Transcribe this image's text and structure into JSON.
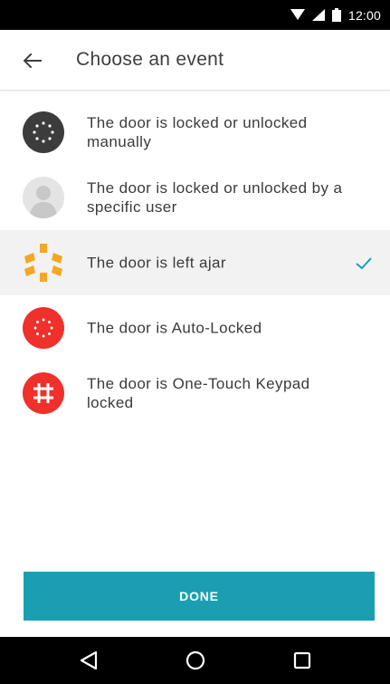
{
  "status_bar": {
    "time": "12:00",
    "icons": [
      "wifi-icon",
      "signal-icon",
      "battery-icon"
    ]
  },
  "app_bar": {
    "title": "Choose an event",
    "back_icon": "arrow-left-icon"
  },
  "events": [
    {
      "label": "The door is locked or unlocked manually",
      "icon": "manual-lock-icon",
      "icon_color": "#3c3c3c",
      "selected": false
    },
    {
      "label": "The door is locked or unlocked by a specific user",
      "icon": "user-avatar-icon",
      "icon_color": "#e4e4e4",
      "selected": false
    },
    {
      "label": "The door is left ajar",
      "icon": "door-ajar-icon",
      "icon_color": "#f5a623",
      "selected": true
    },
    {
      "label": "The door is Auto-Locked",
      "icon": "auto-lock-icon",
      "icon_color": "#f0302a",
      "selected": false
    },
    {
      "label": "The door is One-Touch Keypad locked",
      "icon": "keypad-hash-icon",
      "icon_color": "#f0302a",
      "selected": false
    }
  ],
  "check_color": "#1a9fb2",
  "done_button": {
    "label": "DONE",
    "color": "#1a9fb2"
  },
  "nav_bar": {
    "buttons": [
      "back-triangle-icon",
      "home-circle-icon",
      "recents-square-icon"
    ]
  }
}
